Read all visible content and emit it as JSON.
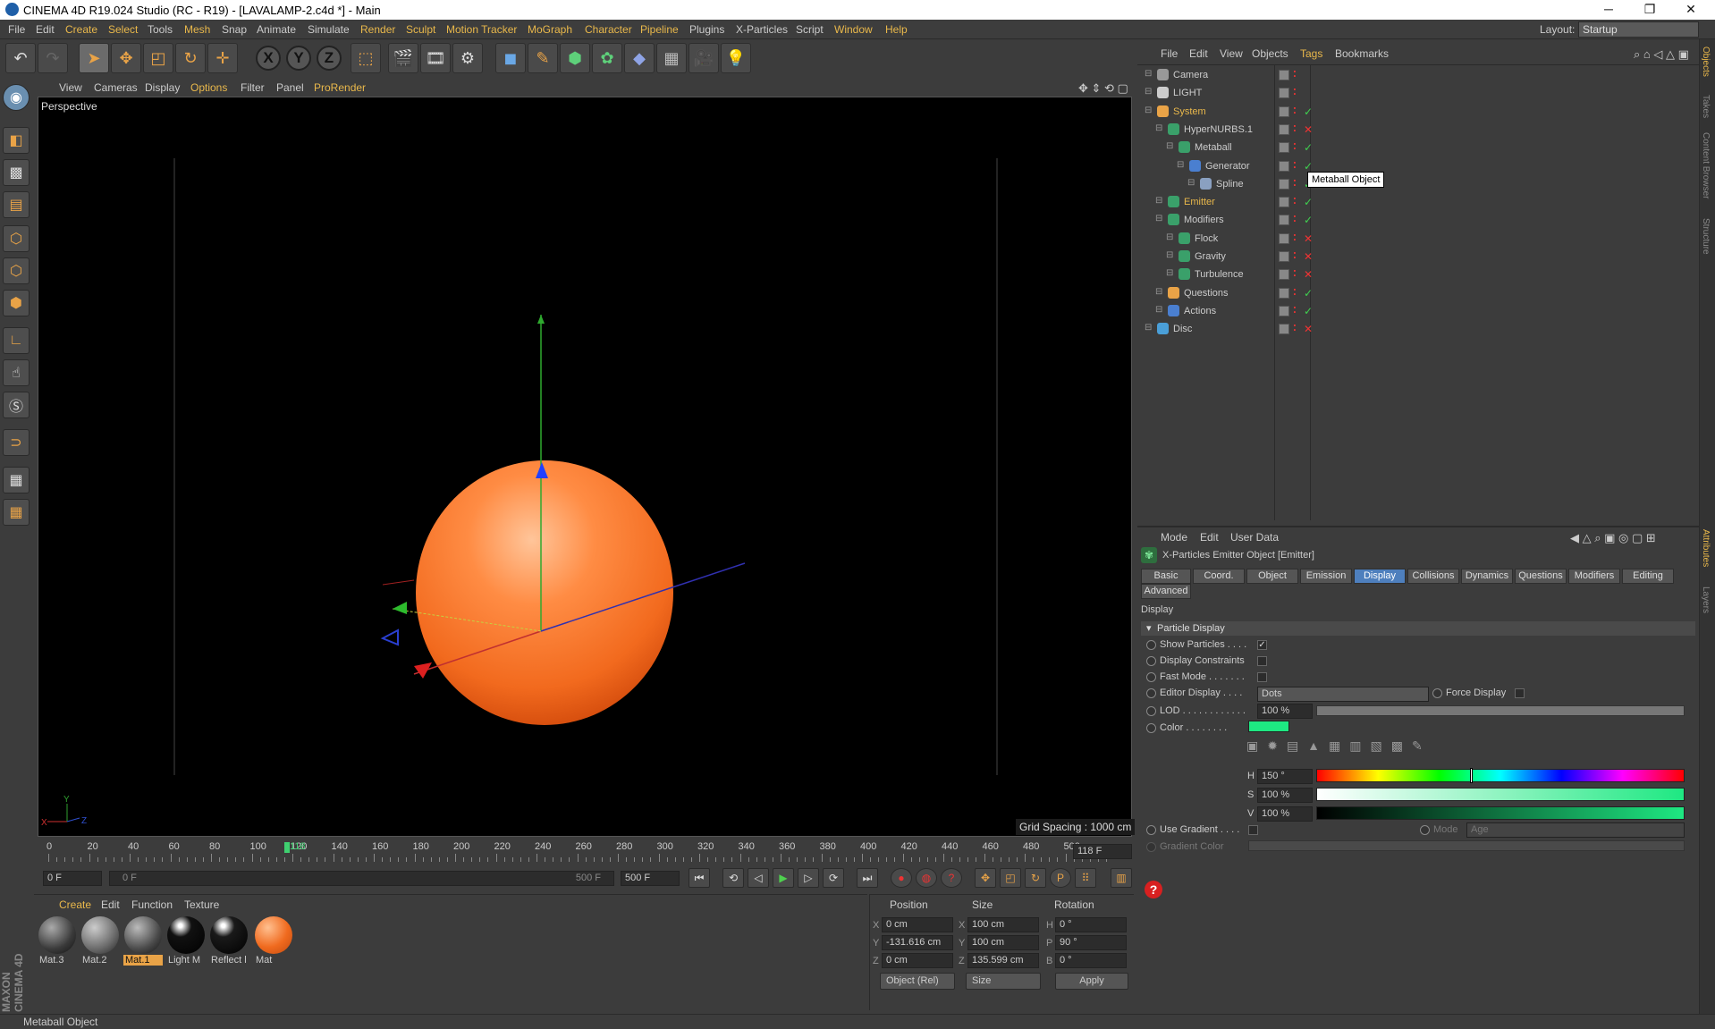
{
  "window": {
    "title": "CINEMA 4D R19.024 Studio (RC - R19) - [LAVALAMP-2.c4d *] - Main"
  },
  "menubar": {
    "items": [
      "File",
      "Edit",
      "Create",
      "Select",
      "Tools",
      "Mesh",
      "Snap",
      "Animate",
      "Simulate",
      "Render",
      "Sculpt",
      "Motion Tracker",
      "MoGraph",
      "Character",
      "Pipeline",
      "Plugins",
      "X-Particles",
      "Script",
      "Window",
      "Help"
    ],
    "layout_label": "Layout:",
    "layout_value": "Startup"
  },
  "viewport": {
    "menu": [
      "View",
      "Cameras",
      "Display",
      "Options",
      "Filter",
      "Panel",
      "ProRender"
    ],
    "label": "Perspective",
    "grid_spacing": "Grid Spacing : 1000 cm",
    "axis_labels": {
      "x": "X",
      "y": "Y",
      "z": "Z"
    }
  },
  "timeline": {
    "ticks": [
      "0",
      "20",
      "40",
      "60",
      "80",
      "100",
      "120",
      "140",
      "160",
      "180",
      "200",
      "220",
      "240",
      "260",
      "280",
      "300",
      "320",
      "340",
      "360",
      "380",
      "400",
      "420",
      "440",
      "460",
      "480",
      "500"
    ],
    "current_frame": "118",
    "current_field": "118 F",
    "start_field": "0 F",
    "range_start": "0 F",
    "range_end": "500 F",
    "end_field": "500 F"
  },
  "materials": {
    "menu": [
      "Create",
      "Edit",
      "Function",
      "Texture"
    ],
    "items": [
      {
        "name": "Mat.3",
        "color": "#3a3a3a"
      },
      {
        "name": "Mat.2",
        "color": "#6a6a6a"
      },
      {
        "name": "Mat.1",
        "color": "#4a4a4a",
        "selected": true
      },
      {
        "name": "Light M",
        "color": "#111111"
      },
      {
        "name": "Reflect l",
        "color": "#1a1a1a"
      },
      {
        "name": "Mat",
        "color": "#f06a1e"
      }
    ],
    "branding": "MAXON CINEMA 4D"
  },
  "coordinates": {
    "headers": {
      "position": "Position",
      "size": "Size",
      "rotation": "Rotation"
    },
    "rows": [
      {
        "axis": "X",
        "pos": "0 cm",
        "size_axis": "X",
        "size": "100 cm",
        "rot_axis": "H",
        "rot": "0 °"
      },
      {
        "axis": "Y",
        "pos": "-131.616 cm",
        "size_axis": "Y",
        "size": "100 cm",
        "rot_axis": "P",
        "rot": "90 °"
      },
      {
        "axis": "Z",
        "pos": "0 cm",
        "size_axis": "Z",
        "size": "135.599 cm",
        "rot_axis": "B",
        "rot": "0 °"
      }
    ],
    "mode_select": "Object (Rel)",
    "size_select": "Size",
    "apply_label": "Apply"
  },
  "status": {
    "text": "Metaball Object"
  },
  "object_manager": {
    "menu": [
      "File",
      "Edit",
      "View",
      "Objects",
      "Tags",
      "Bookmarks"
    ],
    "rows": [
      {
        "name": "Camera",
        "indent": 0,
        "color": "#999999",
        "state": "x",
        "vis": ""
      },
      {
        "name": "LIGHT",
        "indent": 0,
        "color": "#cccccc",
        "state": "x",
        "vis": ""
      },
      {
        "name": "System",
        "indent": 0,
        "color": "#e9a347",
        "state": "c",
        "vis": "✓",
        "yellow": true
      },
      {
        "name": "HyperNURBS.1",
        "indent": 1,
        "color": "#3aa06a",
        "state": "c",
        "vis": "✕"
      },
      {
        "name": "Metaball",
        "indent": 2,
        "color": "#3aa06a",
        "state": "c",
        "vis": "✓"
      },
      {
        "name": "Generator",
        "indent": 3,
        "color": "#4a7fd0",
        "state": "c",
        "vis": "✓"
      },
      {
        "name": "Spline",
        "indent": 4,
        "color": "#8aa0c0",
        "state": "c",
        "vis": "✓"
      },
      {
        "name": "Emitter",
        "indent": 1,
        "color": "#3aa06a",
        "state": "c",
        "vis": "✓",
        "yellow": true
      },
      {
        "name": "Modifiers",
        "indent": 1,
        "color": "#3aa06a",
        "state": "c",
        "vis": "✓"
      },
      {
        "name": "Flock",
        "indent": 2,
        "color": "#3aa06a",
        "state": "c",
        "vis": "✕"
      },
      {
        "name": "Gravity",
        "indent": 2,
        "color": "#3aa06a",
        "state": "c",
        "vis": "✕"
      },
      {
        "name": "Turbulence",
        "indent": 2,
        "color": "#3aa06a",
        "state": "c",
        "vis": "✕"
      },
      {
        "name": "Questions",
        "indent": 1,
        "color": "#e9a347",
        "state": "c",
        "vis": "✓"
      },
      {
        "name": "Actions",
        "indent": 1,
        "color": "#4a7fd0",
        "state": "c",
        "vis": "✓"
      },
      {
        "name": "Disc",
        "indent": 0,
        "color": "#4a9fd8",
        "state": "c",
        "vis": "✕"
      }
    ],
    "tooltip": "Metaball Object"
  },
  "attributes": {
    "menu": [
      "Mode",
      "Edit",
      "User Data"
    ],
    "title": "X-Particles Emitter Object [Emitter]",
    "tabs": [
      "Basic",
      "Coord.",
      "Object",
      "Emission",
      "Display",
      "Collisions",
      "Dynamics",
      "Questions",
      "Modifiers",
      "Editing"
    ],
    "tab2": "Advanced",
    "active_tab": "Display",
    "section": "Display",
    "group": "Particle Display",
    "show_particles": "Show Particles . . . .",
    "display_constraints": "Display Constraints",
    "fast_mode": "Fast Mode . . . . . . .",
    "editor_display": "Editor Display . . . .",
    "editor_display_value": "Dots",
    "force_display": "Force Display",
    "lod": "LOD . . . . . . . . . . . .",
    "lod_value": "100 %",
    "color": "Color . . . . . . . .",
    "color_hex": "#1ee882",
    "h_label": "H",
    "h_value": "150 °",
    "h_fraction": 0.417,
    "s_label": "S",
    "s_value": "100 %",
    "v_label": "V",
    "v_value": "100 %",
    "use_gradient": "Use Gradient . . . .",
    "mode_label": "Mode",
    "mode_value": "Age",
    "gradient_color": "Gradient Color"
  },
  "right_strip": {
    "tabs_top": [
      "Objects",
      "Takes",
      "Content Browser",
      "Structure"
    ],
    "tabs_bottom": [
      "Attributes",
      "Layers"
    ]
  }
}
